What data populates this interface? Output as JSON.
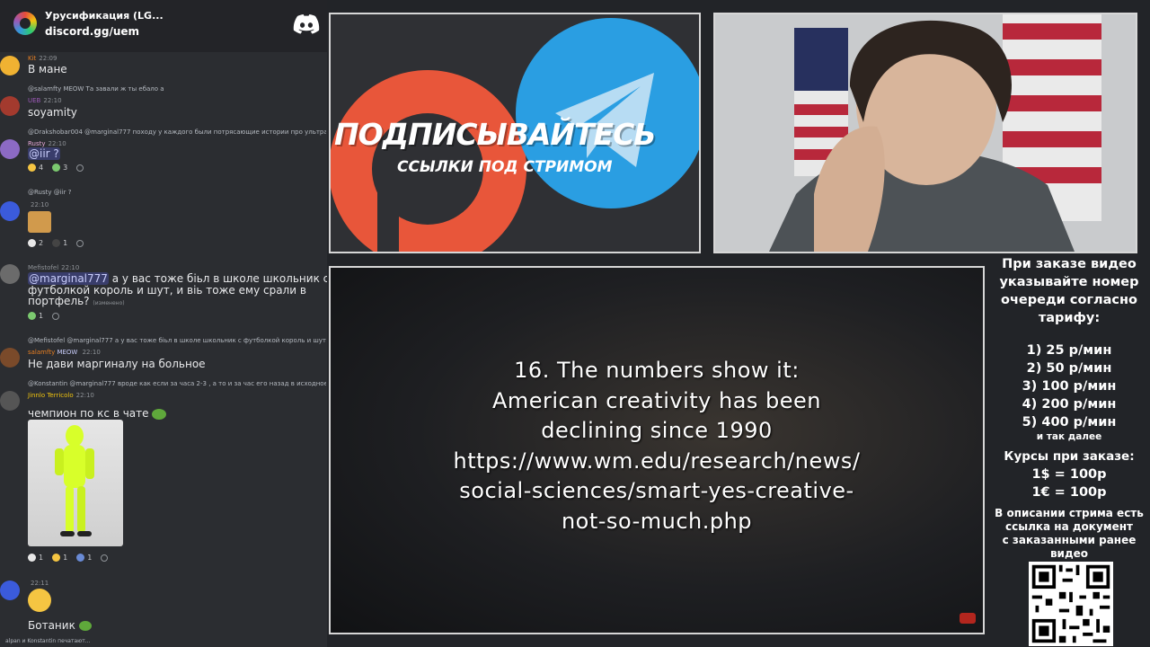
{
  "discord": {
    "server_name": "Урусификация (LG...",
    "invite": "discord.gg/uem"
  },
  "chat": [
    {
      "name": "Kit",
      "time": "22:09",
      "text": "В мане",
      "avatar_color": "#f0b232"
    },
    {
      "reply": "@salamfty MEOW Та завали ж ты ебало а",
      "name": "UEB",
      "time": "22:10",
      "text": "soyamity",
      "avatar_color": "#a33a2e"
    },
    {
      "reply": "@Drakshobar004 @marginal777 походу у каждого были потрясающие истории про ультранасил",
      "name": "Rusty",
      "time": "22:10",
      "text": "@iir ?",
      "avatar_color": "#8c6ac4",
      "reactions": [
        "4",
        "3"
      ]
    },
    {
      "reply": "@Rusty @iir ?",
      "time": "22:10",
      "avatar_color": "#3b5bdb",
      "reactions": [
        "2",
        "1"
      ]
    },
    {
      "name": "Mefistofel",
      "time": "22:10",
      "text_parts": [
        "@marginal777",
        " а у вас тоже біьл в школе школьник с",
        "футболкой король и шут, и віь тоже ему срали в",
        "портфель?"
      ],
      "edited": "(изменено)",
      "avatar_color": "#6b6b6b",
      "reactions": [
        "1"
      ]
    },
    {
      "reply": "@Mefistofel @marginal777 а у вас тоже біьл в школе школьник с футболкой король и шут, и віь",
      "name": "salamfty",
      "badge": "MEOW",
      "time": "22:10",
      "text": "Не дави маргиналу на больное",
      "avatar_color": "#7a4a2a"
    },
    {
      "reply": "@Konstantin @marginal777 вроде как если за часа 2-3 , а то и за час его назад в исходное",
      "name": "Jinnlo Terricolo",
      "time": "22:10",
      "text": "чемпион по кс в чате",
      "avatar_color": "#555",
      "reactions": [
        "1",
        "1",
        "1"
      ]
    },
    {
      "time": "22:11",
      "text": "Ботаник",
      "avatar_color": "#3b5bdb"
    }
  ],
  "typing": "alpan и Konstantin печатают...",
  "promo": {
    "title": "ПОДПИСЫВАЙТЕСЬ",
    "subtitle": "ССЫЛКИ ПОД СТРИМОМ"
  },
  "video_subtitle": [
    "16. The numbers show it:",
    "American creativity has been",
    "declining since 1990",
    "https://www.wm.edu/research/news/",
    "social-sciences/smart-yes-creative-",
    "not-so-much.php"
  ],
  "info": {
    "order_note": [
      "При заказе видео",
      "указывайте номер",
      "очереди согласно",
      "тарифу:"
    ],
    "tariffs": [
      "1) 25 р/мин",
      "2) 50 р/мин",
      "3) 100 р/мин",
      "4) 200 р/мин",
      "5) 400 р/мин"
    ],
    "etc": "и так далее",
    "rates_title": "Курсы при заказе:",
    "rates": [
      "1$ = 100р",
      "1€ = 100р"
    ],
    "description_note": [
      "В описании стрима есть",
      "ссылка на документ",
      "с заказанными ранее",
      "видео"
    ]
  }
}
